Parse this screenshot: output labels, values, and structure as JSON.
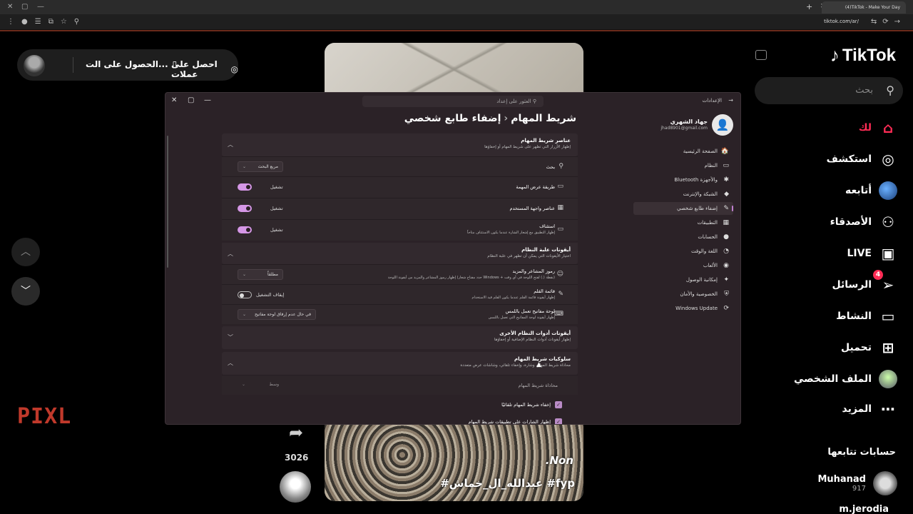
{
  "browser": {
    "tab_title": "(4)TikTok - Make Your Day",
    "url": "tiktok.com/ar/"
  },
  "tiktok": {
    "logo": "TikTok",
    "search_placeholder": "بحث",
    "nav": [
      {
        "label": "لك",
        "icon": "home-icon",
        "active": true
      },
      {
        "label": "استكشف",
        "icon": "compass-icon"
      },
      {
        "label": "أتابعه",
        "icon": "following-avatar"
      },
      {
        "label": "الأصدقاء",
        "icon": "friends-icon"
      },
      {
        "label": "LIVE",
        "icon": "live-tv-icon"
      },
      {
        "label": "الرسائل",
        "icon": "send-icon",
        "badge": "4"
      },
      {
        "label": "النشاط",
        "icon": "message-icon"
      },
      {
        "label": "تحميل",
        "icon": "plus-square-icon"
      },
      {
        "label": "الملف الشخصي",
        "icon": "profile-avatar"
      },
      {
        "label": "المزيد",
        "icon": "more-icon"
      }
    ],
    "following_title": "حسابات تتابعها",
    "following": [
      {
        "name": "Muhanad",
        "handle": "917"
      },
      {
        "name": "m.jerodia"
      }
    ]
  },
  "pill": {
    "coins": "احصل على عملات",
    "get_app": "الحصول على الت..."
  },
  "video": {
    "caption_line1": ".Non",
    "caption_line2": "#عبدالله_ال_خماش #fyp",
    "share_count": "3026"
  },
  "watermark": "PIXL",
  "settings": {
    "app_title": "الإعدادات",
    "search_placeholder": "العثور على إعداد",
    "user": {
      "name": "جهاد الشهري",
      "email": "jhad8901@gmail.com"
    },
    "breadcrumb": {
      "parent": "إضفاء طابع شخصي",
      "current": "شريط المهام"
    },
    "nav": [
      {
        "label": "الصفحة الرئيسية",
        "icon": "🏠"
      },
      {
        "label": "النظام",
        "icon": "▭"
      },
      {
        "label": "Bluetooth والأجهزة",
        "icon": "✱"
      },
      {
        "label": "الشبكة والإنترنت",
        "icon": "◆"
      },
      {
        "label": "إضفاء طابع شخصي",
        "icon": "✎",
        "selected": true
      },
      {
        "label": "التطبيقات",
        "icon": "▦"
      },
      {
        "label": "الحسابات",
        "icon": "●"
      },
      {
        "label": "اللغة والوقت",
        "icon": "◔"
      },
      {
        "label": "الألعاب",
        "icon": "◉"
      },
      {
        "label": "إمكانية الوصول",
        "icon": "✦"
      },
      {
        "label": "الخصوصية والأمان",
        "icon": "⛨"
      },
      {
        "label": "Windows Update",
        "icon": "⟳"
      }
    ],
    "taskbar_items": {
      "title": "عناصر شريط المهام",
      "subtitle": "إظهار الأزرار التي تظهر على شريط المهام أو إخفاؤها",
      "rows": [
        {
          "label": "بحث",
          "control": "مربع البحث"
        },
        {
          "label": "طريقة عرض المهمة",
          "control": "تشغيل"
        },
        {
          "label": "عناصر واجهة المستخدم",
          "control": "تشغيل"
        },
        {
          "label": "استئناف",
          "sub": "إظهار التطبيق مع إشعار الشارة عندما يكون الاستئناف متاحاً",
          "control": "تشغيل"
        }
      ]
    },
    "tray_icons": {
      "title": "أيقونات علبة النظام",
      "subtitle": "اختيار الأيقونات التي يمكن أن تظهر في علبة النظام",
      "rows": [
        {
          "label": "رموز المشاعر والمزيد",
          "sub": "إظهار رموز المشاعر والمزيد من أيقونة اللوحة (حدد مفتاح شعار Windows + نقطة (.) لفتح اللوحة في أي وقت)",
          "control": "مطلقاً"
        },
        {
          "label": "قائمة القلم",
          "sub": "إظهار أيقونة قائمة القلم عندما يكون القلم قيد الاستخدام",
          "control": "إيقاف التشغيل"
        },
        {
          "label": "لوحة مفاتيح تعمل باللمس",
          "sub": "إظهار أيقونة لوحة المفاتيح التي تعمل باللمس",
          "control": "في حال عدم إرفاق لوحة مفاتيح"
        }
      ]
    },
    "other_tray": {
      "title": "أيقونات أدوات النظام الأخرى",
      "subtitle": "إظهار أيقونات أدوات النظام الإضافية أو إخفاؤها"
    },
    "behaviors": {
      "title": "سلوكيات شريط المهام",
      "subtitle": "محاذاة شريط المهام، وشارة، وإخفاء تلقائي، وشاشات عرض متعددة",
      "alignment_label": "محاذاة شريط المهام",
      "alignment_value": "وسط",
      "auto_hide": "إخفاء شريط المهام تلقائيًا",
      "badges": "إظهار الشارات على تطبيقات شريط المهام"
    }
  }
}
